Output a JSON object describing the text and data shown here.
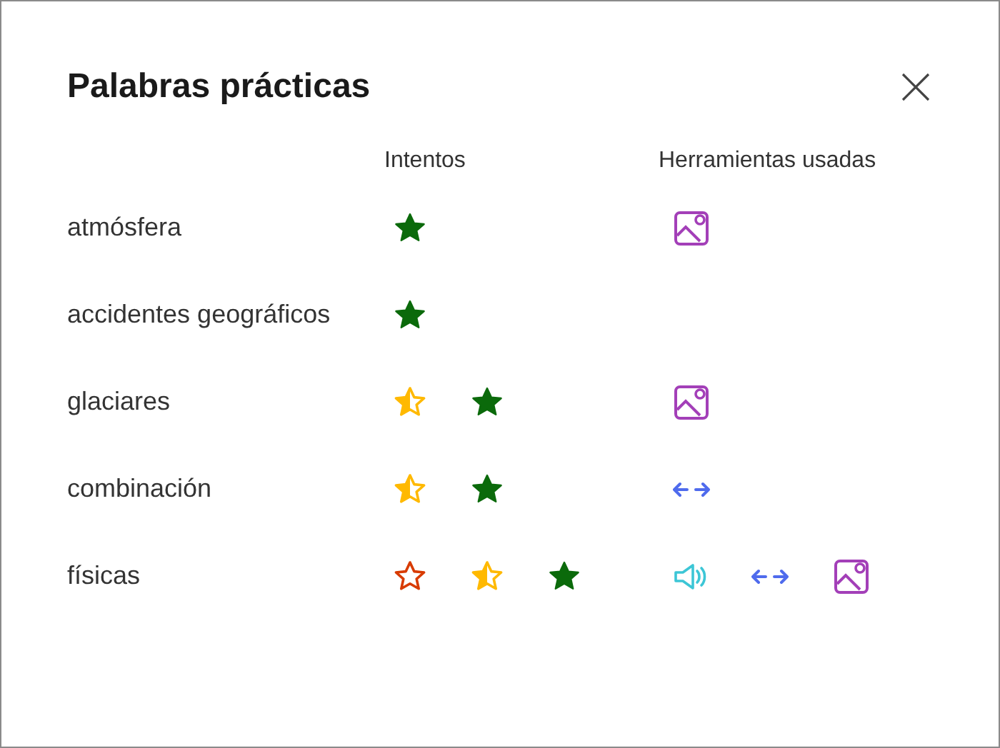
{
  "title": "Palabras prácticas",
  "columns": [
    "Intentos",
    "Herramientas usadas"
  ],
  "rows": [
    {
      "word": "atmósfera",
      "attempts": [
        {
          "kind": "correct"
        }
      ],
      "tools": [
        {
          "kind": "picture"
        }
      ]
    },
    {
      "word": "accidentes geográficos",
      "attempts": [
        {
          "kind": "correct"
        }
      ],
      "tools": []
    },
    {
      "word": "glaciares",
      "attempts": [
        {
          "kind": "partial"
        },
        {
          "kind": "correct"
        }
      ],
      "tools": [
        {
          "kind": "picture"
        }
      ]
    },
    {
      "word": "combinación",
      "attempts": [
        {
          "kind": "partial"
        },
        {
          "kind": "correct"
        }
      ],
      "tools": [
        {
          "kind": "split"
        }
      ]
    },
    {
      "word": "físicas",
      "attempts": [
        {
          "kind": "wrong"
        },
        {
          "kind": "partial"
        },
        {
          "kind": "correct"
        }
      ],
      "tools": [
        {
          "kind": "audio"
        },
        {
          "kind": "split"
        },
        {
          "kind": "picture"
        }
      ]
    }
  ]
}
